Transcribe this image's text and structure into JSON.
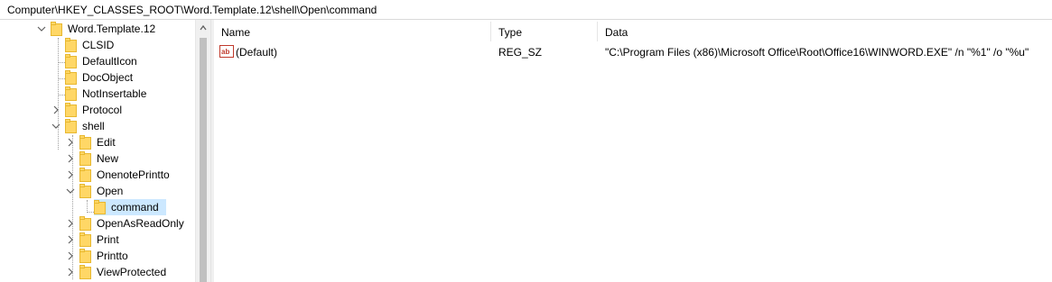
{
  "address": {
    "path": "Computer\\HKEY_CLASSES_ROOT\\Word.Template.12\\shell\\Open\\command"
  },
  "tree": {
    "items": [
      {
        "label": "Word.Template.12",
        "expanded": true,
        "icon": "folder-icon"
      },
      {
        "label": "CLSID",
        "icon": "folder-icon"
      },
      {
        "label": "DefaultIcon",
        "icon": "folder-icon"
      },
      {
        "label": "DocObject",
        "icon": "folder-icon"
      },
      {
        "label": "NotInsertable",
        "icon": "folder-icon"
      },
      {
        "label": "Protocol",
        "expanded": false,
        "icon": "folder-icon"
      },
      {
        "label": "shell",
        "expanded": true,
        "icon": "folder-icon"
      },
      {
        "label": "Edit",
        "expanded": false,
        "icon": "folder-icon"
      },
      {
        "label": "New",
        "expanded": false,
        "icon": "folder-icon"
      },
      {
        "label": "OnenotePrintto",
        "expanded": false,
        "icon": "folder-icon"
      },
      {
        "label": "Open",
        "expanded": true,
        "icon": "folder-icon"
      },
      {
        "label": "command",
        "selected": true,
        "icon": "folder-open-icon"
      },
      {
        "label": "OpenAsReadOnly",
        "expanded": false,
        "icon": "folder-icon"
      },
      {
        "label": "Print",
        "expanded": false,
        "icon": "folder-icon"
      },
      {
        "label": "Printto",
        "expanded": false,
        "icon": "folder-icon"
      },
      {
        "label": "ViewProtected",
        "expanded": false,
        "icon": "folder-icon"
      }
    ]
  },
  "list": {
    "columns": [
      "Name",
      "Type",
      "Data"
    ],
    "rows": [
      {
        "name": "(Default)",
        "type": "REG_SZ",
        "data": "\"C:\\Program Files (x86)\\Microsoft Office\\Root\\Office16\\WINWORD.EXE\" /n \"%1\" /o \"%u\"",
        "icon": "string-value-icon"
      }
    ]
  },
  "colors": {
    "selection": "#cce8ff",
    "folder": "#ffd766",
    "folder_dark": "#e8b830"
  }
}
